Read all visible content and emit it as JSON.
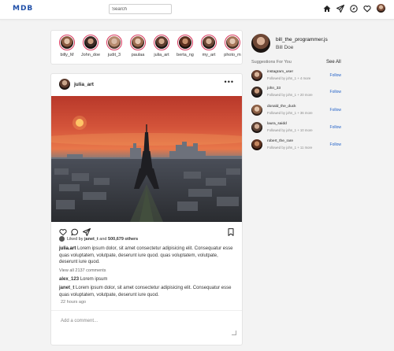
{
  "header": {
    "logo": "MDB",
    "search_placeholder": "Search",
    "icons": [
      "home-icon",
      "send-icon",
      "compass-icon",
      "heart-icon",
      "profile-avatar"
    ]
  },
  "stories": [
    {
      "name": "billy_M"
    },
    {
      "name": "John_doe"
    },
    {
      "name": "judit_3"
    },
    {
      "name": "paulaa"
    },
    {
      "name": "julia_art"
    },
    {
      "name": "berta_ng"
    },
    {
      "name": "my_art"
    },
    {
      "name": "photo_m"
    }
  ],
  "post": {
    "username": "julia_art",
    "more": "•••",
    "liked_by_prefix": "Liked by",
    "liked_by_user": "janet_t",
    "liked_by_and": "and",
    "liked_by_count": "500,679 others",
    "caption_user": "julia.art",
    "caption_text": "Lorem ipsum dolor, sit amet consectetur adipisicing elit. Consequatur esse quas voluptatem, volutpate, deserunt iure quod. quas voluptatem, volutpate, deserunt iure quod.",
    "view_all": "View all 2137 comments",
    "comment1_user": "alex_123",
    "comment1_text": "Lorem ipsum",
    "comment2_user": "janet_t",
    "comment2_text": "Lorem ipsum dolor, sit amet consectetur adipisicing elit. Consequatur esse quas voluptatem, volutpate, deserunt iure quod.",
    "time": "22 hours ago",
    "add_comment_placeholder": "Add a comment..."
  },
  "sidebar": {
    "username": "bill_the_programmer.js",
    "name": "Bill Doe",
    "suggestions_title": "Suggestions For You",
    "see_all": "See All",
    "suggestions": [
      {
        "user": "instagram_user",
        "followed": "Followed by john_1 + 4 more",
        "action": "Follow"
      },
      {
        "user": "john_33",
        "followed": "Followed by john_1 + 20 more",
        "action": "Follow"
      },
      {
        "user": "donald_the_duck",
        "followed": "Followed by john_1 + 36 more",
        "action": "Follow"
      },
      {
        "user": "laura_saidd",
        "followed": "Followed by john_1 + 10 more",
        "action": "Follow"
      },
      {
        "user": "robert_the_rare",
        "followed": "Followed by john_1 + 11 more",
        "action": "Follow"
      }
    ]
  },
  "colors": {
    "brand": "#1f4fa8",
    "story_ring": "#d9365c",
    "follow": "#2563c9",
    "sky_top": "#d4543a",
    "sky_low": "#f08a4b"
  }
}
